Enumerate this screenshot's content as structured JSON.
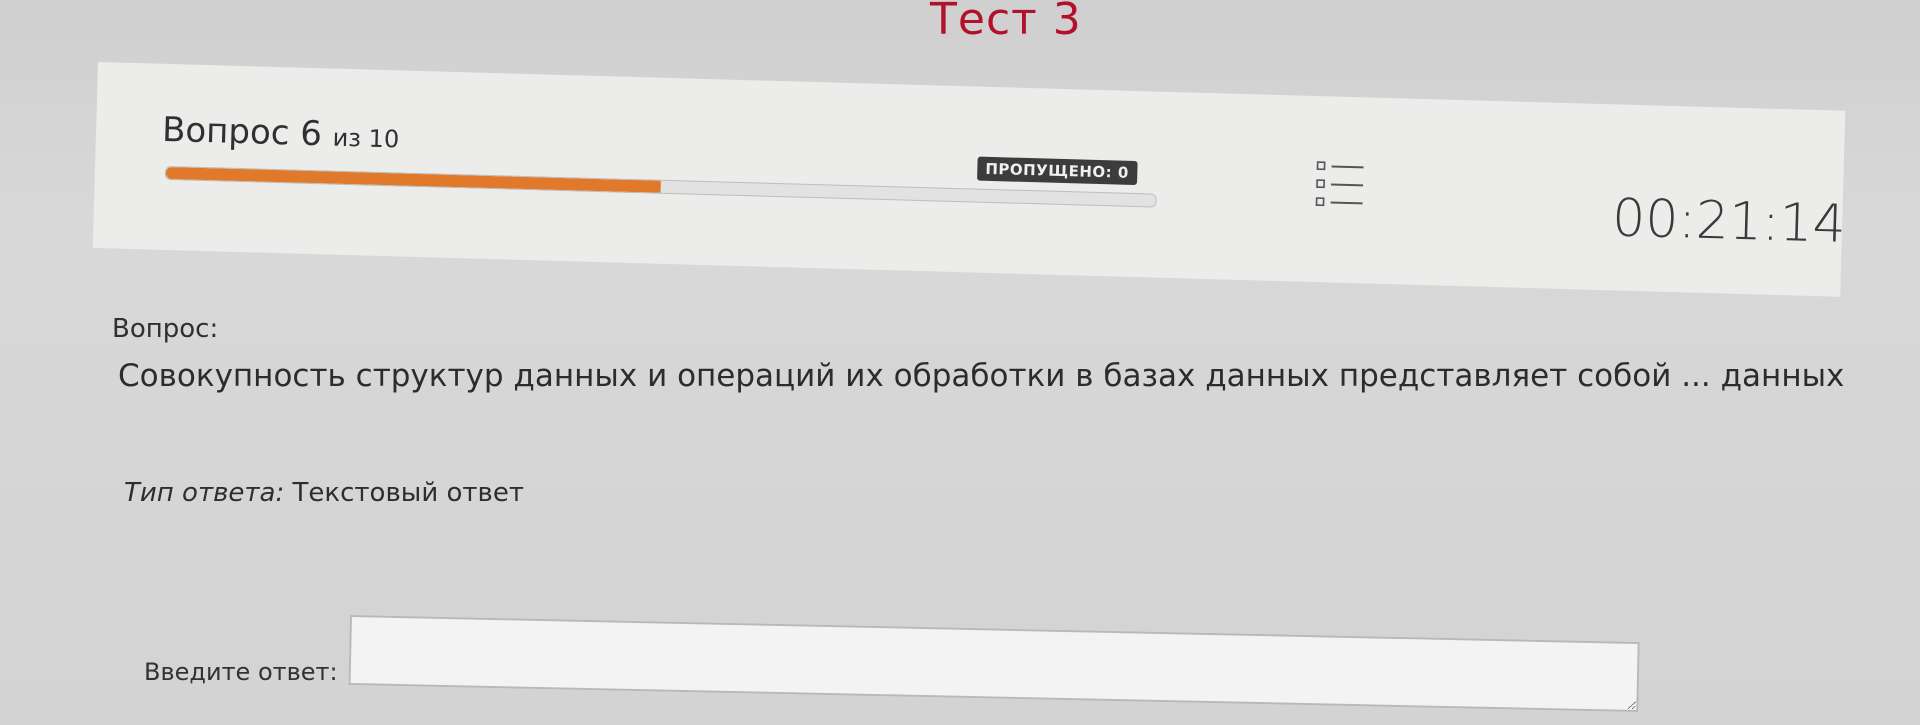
{
  "header": {
    "test_title": "Тест 3"
  },
  "status": {
    "question_word": "Вопрос",
    "question_current": "6",
    "question_of": "из 10",
    "progress_fraction": 0.5,
    "skipped_label": "ПРОПУЩЕНО: 0",
    "timer": "00:21:14",
    "question_list_icon": "list-checkbox-icon"
  },
  "question": {
    "label": "Вопрос:",
    "text": "Совокупность структур данных и операций их обработки в базах данных представляет собой ... данных"
  },
  "answer": {
    "type_label": "Тип ответа:",
    "type_value": "Текстовый ответ",
    "input_label": "Введите ответ:",
    "input_value": ""
  },
  "colors": {
    "title": "#b2102b",
    "progress": "#e07a2a",
    "badge": "#3c3c3c"
  }
}
